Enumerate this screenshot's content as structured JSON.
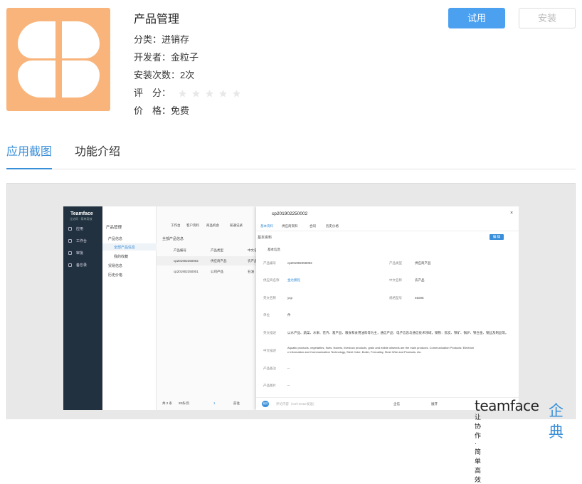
{
  "app": {
    "title": "产品管理",
    "category_label": "分类：",
    "category_value": "进销存",
    "developer_label": "开发者：",
    "developer_value": "金粒子",
    "installs_label": "安装次数：",
    "installs_value": "2次",
    "rating_label": "评　分：",
    "rating_stars": 0,
    "rating_max": 5,
    "price_label": "价　格：",
    "price_value": "免费",
    "icon_color": "#f9b47b"
  },
  "actions": {
    "try_label": "试用",
    "install_label": "安装"
  },
  "tabs": [
    {
      "label": "应用截图"
    },
    {
      "label": "功能介绍"
    }
  ],
  "screenshot": {
    "nav": {
      "logo": "Teamface",
      "subtitle": "让协同 · 简单高效",
      "items": [
        "应用",
        "工作台",
        "审批",
        "备忘录"
      ]
    },
    "side": {
      "title": "产品管理",
      "items": [
        "产品信息",
        "全部产品信息",
        "我的收藏",
        "贸易信息",
        "历史价格"
      ]
    },
    "table": {
      "tabs": [
        "工作台",
        "客户资料",
        "商品机会",
        "知通记录"
      ],
      "heading": "全部产品信息",
      "columns": [
        "产品编号",
        "产品类型",
        "中文名"
      ],
      "rows": [
        [
          "cp201902250002",
          "供应商产品",
          "农产品"
        ],
        [
          "cp201902250001",
          "公司产品",
          "石油"
        ]
      ],
      "footer_total": "共 2 条",
      "footer_page_size": "20条/页",
      "footer_page": "1",
      "footer_goto": "前往"
    },
    "detail": {
      "title": "cp201902250002",
      "tabs": [
        "基本资料",
        "供应商资料",
        "合同",
        "历史价格"
      ],
      "section": "基本资料",
      "sub_section": "基本信息",
      "edit_label": "编 辑",
      "fields": {
        "product_no_label": "产品编号",
        "product_no": "cp201902250002",
        "product_type_label": "产品类型",
        "product_type": "供应商产品",
        "supplier_label": "供应商名称",
        "supplier": "金达鹏程",
        "cn_name_label": "中文名称",
        "cn_name": "农产品",
        "en_name_label": "英文名称",
        "en_name": "ycp",
        "spec_label": "规格型号",
        "spec": "01005",
        "unit_label": "单位",
        "unit": "件",
        "en_desc_label": "英文描述",
        "en_desc": "以水产品、蔬菜、水果、花卉、畜产品、粮食和食用油料等为主，通信产品：电子信息与通信技术领域，钢铁：焦炭、铁矿、锅炉、铁合金、钢丝及制品等。",
        "cn_desc_label": "中文描述",
        "cn_desc_1": "Aquatic products, vegetables, fruits, flowers, livestock products, grain and edible oilseeds are the main products. Communication Products: Electroni",
        "cn_desc_2": "c Information and Communication Technology, Steel Coke, Boiler, Ferroalloy, Steel Wire and Products, etc.",
        "remark_label": "产品备注",
        "remark": "--",
        "image_label": "产品图片",
        "image": "--"
      },
      "comment_placeholder": "评论内容（Ctrl+Enter发送）",
      "comment_avatar": "我的",
      "follow_label": "企信",
      "expand_label": "展开"
    }
  },
  "watermark": {
    "brand_en": "teamface",
    "brand_cn": "企典",
    "tagline": "让协作·简单高效"
  }
}
